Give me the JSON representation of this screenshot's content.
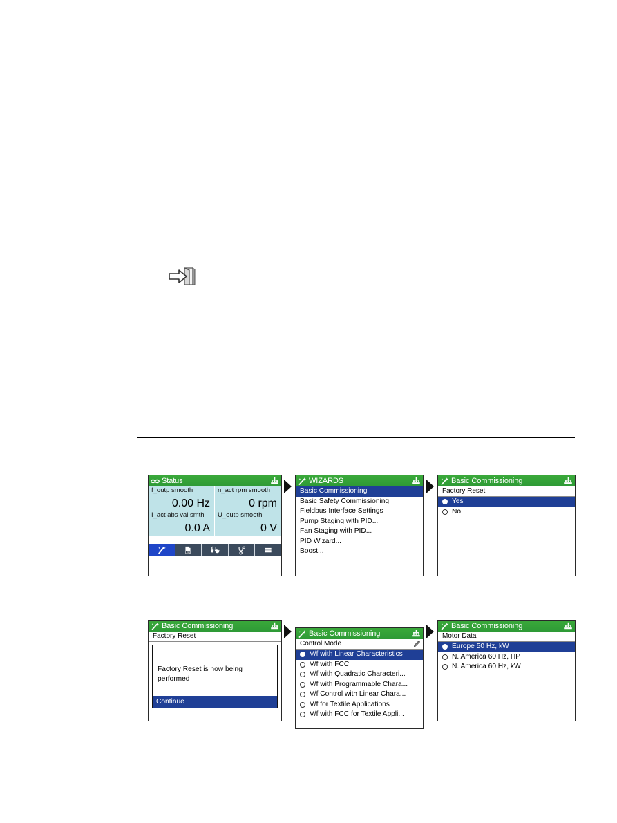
{
  "page": {
    "rules": [
      "top-rule",
      "middle-rule",
      "bottom-rule"
    ],
    "doc_icon_name": "arrow-into-book-icon"
  },
  "panels": [
    {
      "id": "status",
      "header": {
        "title": "Status",
        "left_icon": "binoculars-icon",
        "right_icon": "hierarchy-tree-icon"
      },
      "tiles": [
        {
          "label": "f_outp smooth",
          "value": "0.00 Hz"
        },
        {
          "label": "n_act rpm smooth",
          "value": "0 rpm"
        },
        {
          "label": "I_act abs val smth",
          "value": "0.0 A"
        },
        {
          "label": "U_outp smooth",
          "value": "0 V"
        }
      ],
      "toolbar": [
        {
          "name": "wizard-wand-icon",
          "active": true
        },
        {
          "name": "parameter-doc-icon",
          "label": "01",
          "active": false
        },
        {
          "name": "manual-control-icon",
          "active": false
        },
        {
          "name": "diagnostics-stethoscope-icon",
          "active": false
        },
        {
          "name": "menu-hamburger-icon",
          "active": false
        }
      ]
    },
    {
      "id": "wizards",
      "header": {
        "title": "WIZARDS",
        "left_icon": "wizard-wand-icon",
        "right_icon": "hierarchy-tree-icon"
      },
      "items": [
        {
          "label": "Basic Commissioning",
          "selected": true
        },
        {
          "label": "Basic Safety Commissioning",
          "selected": false
        },
        {
          "label": "Fieldbus Interface Settings",
          "selected": false
        },
        {
          "label": "Pump Staging with PID...",
          "selected": false
        },
        {
          "label": "Fan Staging with PID...",
          "selected": false
        },
        {
          "label": "PID Wizard...",
          "selected": false
        },
        {
          "label": "Boost...",
          "selected": false
        }
      ]
    },
    {
      "id": "factory-reset-choice",
      "header": {
        "title": "Basic Commissioning",
        "left_icon": "wizard-wand-icon",
        "right_icon": "hierarchy-tree-icon"
      },
      "subbar": {
        "label": "Factory Reset",
        "pencil": false
      },
      "options": [
        {
          "label": "Yes",
          "selected": true
        },
        {
          "label": "No",
          "selected": false
        }
      ]
    },
    {
      "id": "factory-reset-progress",
      "header": {
        "title": "Basic Commissioning",
        "left_icon": "wizard-wand-icon",
        "right_icon": "hierarchy-tree-icon"
      },
      "subbar": {
        "label": "Factory Reset",
        "pencil": false
      },
      "message": "Factory Reset is now being performed",
      "action_label": "Continue"
    },
    {
      "id": "control-mode",
      "header": {
        "title": "Basic Commissioning",
        "left_icon": "wizard-wand-icon",
        "right_icon": "hierarchy-tree-icon"
      },
      "subbar": {
        "label": "Control Mode",
        "pencil": true,
        "pencil_icon": "pencil-edit-icon"
      },
      "options": [
        {
          "label": "V/f with Linear Characteristics",
          "selected": true
        },
        {
          "label": "V/f with FCC",
          "selected": false
        },
        {
          "label": "V/f with Quadratic Characteri...",
          "selected": false
        },
        {
          "label": "V/f with Programmable Chara...",
          "selected": false
        },
        {
          "label": "V/f Control with Linear Chara...",
          "selected": false
        },
        {
          "label": "V/f for Textile Applications",
          "selected": false
        },
        {
          "label": "V/f with FCC for Textile Appli...",
          "selected": false
        }
      ]
    },
    {
      "id": "motor-data",
      "header": {
        "title": "Basic Commissioning",
        "left_icon": "wizard-wand-icon",
        "right_icon": "hierarchy-tree-icon"
      },
      "subbar": {
        "label": "Motor Data",
        "pencil": false
      },
      "options": [
        {
          "label": "Europe 50 Hz, kW",
          "selected": true
        },
        {
          "label": "N. America 60 Hz, HP",
          "selected": false
        },
        {
          "label": "N. America 60 Hz, kW",
          "selected": false
        }
      ]
    }
  ],
  "colors": {
    "header_green": "#2e9a36",
    "selection_blue": "#1f3f96",
    "tile_cyan": "#bfe3e8",
    "toolbar_slate": "#3b4a5c",
    "toolbar_active_blue": "#1f46c8"
  }
}
